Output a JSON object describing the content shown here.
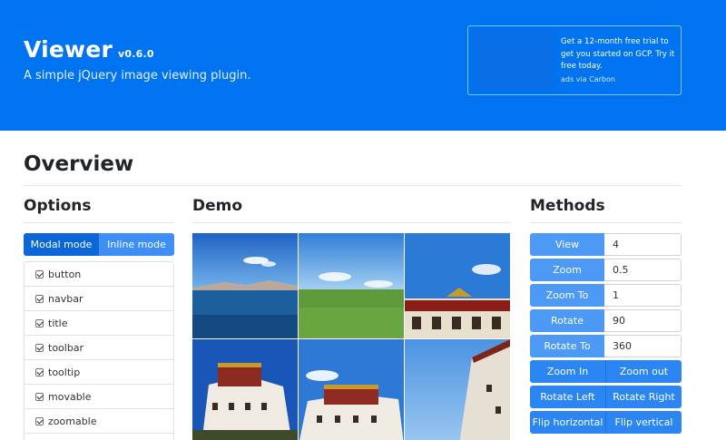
{
  "hero": {
    "title": "Viewer",
    "version": "v0.6.0",
    "subtitle": "A simple jQuery image viewing plugin.",
    "ad_text": "Get a 12-month free trial to get you started on GCP. Try it free today.",
    "ad_via": "ads via Carbon",
    "color": "#0074f0"
  },
  "overview_title": "Overview",
  "options": {
    "heading": "Options",
    "tabs": [
      "Modal mode",
      "Inline mode"
    ],
    "active_tab": "Modal mode",
    "items": [
      "button",
      "navbar",
      "title",
      "toolbar",
      "tooltip",
      "movable",
      "zoomable"
    ]
  },
  "demo": {
    "heading": "Demo"
  },
  "methods": {
    "heading": "Methods",
    "inputs": [
      {
        "label": "View",
        "value": "4"
      },
      {
        "label": "Zoom",
        "value": "0.5"
      },
      {
        "label": "Zoom To",
        "value": "1"
      },
      {
        "label": "Rotate",
        "value": "90"
      },
      {
        "label": "Rotate To",
        "value": "360"
      }
    ],
    "pairs": [
      [
        "Zoom In",
        "Zoom out"
      ],
      [
        "Rotate Left",
        "Rotate Right"
      ],
      [
        "Flip horizontal",
        "Flip vertical"
      ]
    ]
  }
}
